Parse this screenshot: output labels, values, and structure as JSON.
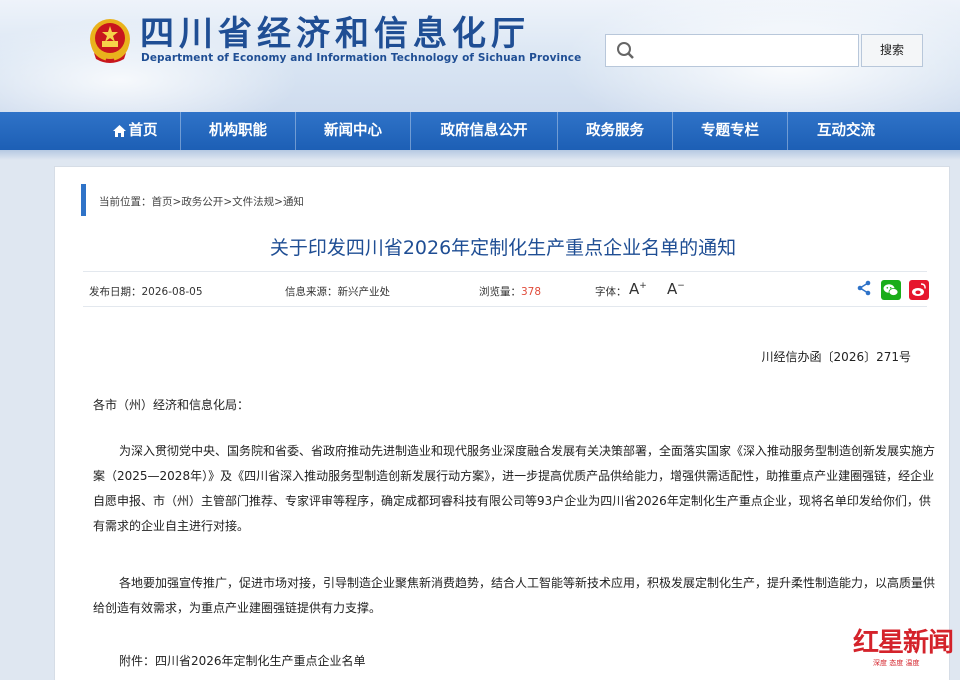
{
  "header": {
    "title_cn": "四川省经济和信息化厅",
    "title_en": "Department of Economy and Information Technology of Sichuan Province"
  },
  "search": {
    "placeholder": "",
    "value": "",
    "button_label": "搜索"
  },
  "nav": {
    "items": [
      {
        "label": "首页"
      },
      {
        "label": "机构职能"
      },
      {
        "label": "新闻中心"
      },
      {
        "label": "政府信息公开"
      },
      {
        "label": "政务服务"
      },
      {
        "label": "专题专栏"
      },
      {
        "label": "互动交流"
      }
    ]
  },
  "breadcrumb": {
    "prefix": "当前位置：",
    "items": [
      "首页",
      "政务公开",
      "文件法规",
      "通知"
    ],
    "separator": ">"
  },
  "article": {
    "title": "关于印发四川省2026年定制化生产重点企业名单的通知",
    "meta": {
      "date_label": "发布日期：",
      "date": "2026-08-05",
      "source_label": "信息来源：",
      "source": "新兴产业处",
      "views_label": "浏览量：",
      "views": "378",
      "font_label": "字体："
    },
    "doc_number": "川经信办函〔2026〕271号",
    "salutation": "各市（州）经济和信息化局：",
    "paragraph1": "为深入贯彻党中央、国务院和省委、省政府推动先进制造业和现代服务业深度融合发展有关决策部署，全面落实国家《深入推动服务型制造创新发展实施方案（2025—2028年）》及《四川省深入推动服务型制造创新发展行动方案》，进一步提高优质产品供给能力，增强供需适配性，助推重点产业建圈强链，经企业自愿申报、市（州）主管部门推荐、专家评审等程序，确定成都珂睿科技有限公司等93户企业为四川省2026年定制化生产重点企业，现将名单印发给你们，供有需求的企业自主进行对接。",
    "paragraph2": "各地要加强宣传推广，促进市场对接，引导制造企业聚焦新消费趋势，结合人工智能等新技术应用，积极发展定制化生产，提升柔性制造能力，以高质量供给创造有效需求，为重点产业建圈强链提供有力支撑。",
    "attachment": "附件：四川省2026年定制化生产重点企业名单"
  },
  "watermark": {
    "text": "红星新闻",
    "sub": "深度 态度 温度"
  },
  "colors": {
    "brand_blue": "#1f4e94",
    "nav_blue": "#2f73c8",
    "views_red": "#e04b3a",
    "wechat_green": "#1aad19",
    "weibo_red": "#e6162d"
  }
}
